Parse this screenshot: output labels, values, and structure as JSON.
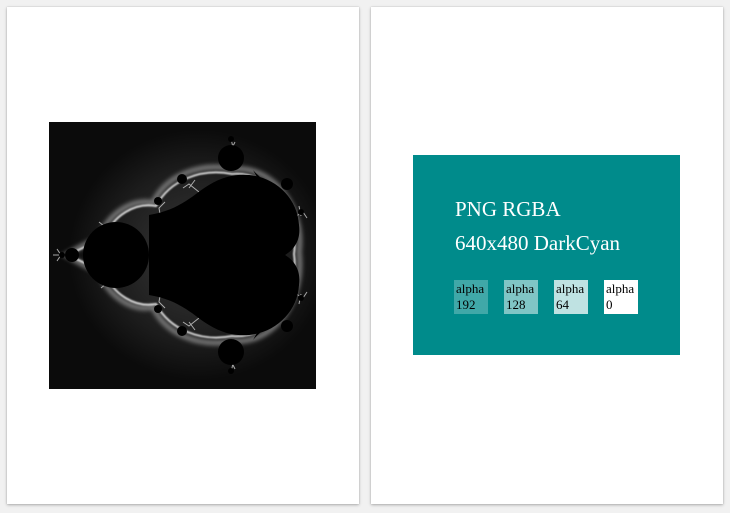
{
  "viewer": {
    "pages": [
      {
        "id": "page-1",
        "image": {
          "icon": "mandelbrot-fractal-image",
          "colors": {
            "background": "#0b0b0b",
            "set": "#000000",
            "halo": "#d8d8d8"
          }
        }
      },
      {
        "id": "page-2",
        "card": {
          "background": "#008b8b",
          "title_line_1": "PNG RGBA",
          "title_line_2": "640x480 DarkCyan",
          "swatches": [
            {
              "label": "alpha",
              "value": "192",
              "alpha": 0.25
            },
            {
              "label": "alpha",
              "value": "128",
              "alpha": 0.5
            },
            {
              "label": "alpha",
              "value": "64",
              "alpha": 0.75
            },
            {
              "label": "alpha",
              "value": "0",
              "alpha": 1.0
            }
          ]
        }
      }
    ]
  }
}
